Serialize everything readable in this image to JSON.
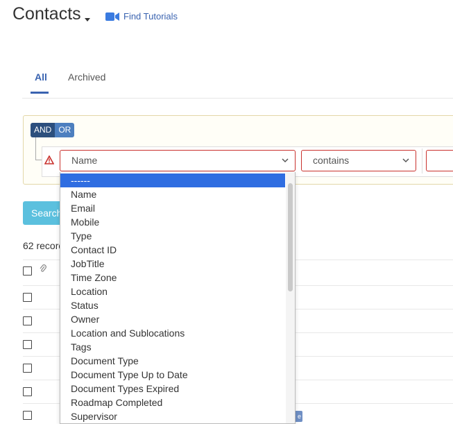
{
  "header": {
    "title": "Contacts",
    "tutorials_label": "Find Tutorials"
  },
  "tabs": [
    {
      "label": "All",
      "active": true
    },
    {
      "label": "Archived",
      "active": false
    }
  ],
  "filter": {
    "and_label": "AND",
    "or_label": "OR",
    "field_value": "Name",
    "operator_value": "contains",
    "value_text": ""
  },
  "search_label": "Search",
  "records_label": "62 records",
  "dropdown": {
    "options": [
      "------",
      "Name",
      "Email",
      "Mobile",
      "Type",
      "Contact ID",
      "JobTitle",
      "Time Zone",
      "Location",
      "Status",
      "Owner",
      "Location and Sublocations",
      "Tags",
      "Document Type",
      "Document Type Up to Date",
      "Document Types Expired",
      "Roadmap Completed",
      "Supervisor"
    ],
    "selected_index": 0
  },
  "colors": {
    "primary": "#3a63b0",
    "error": "#c9302c",
    "info": "#5bc0de",
    "highlight": "#2f6de1"
  }
}
